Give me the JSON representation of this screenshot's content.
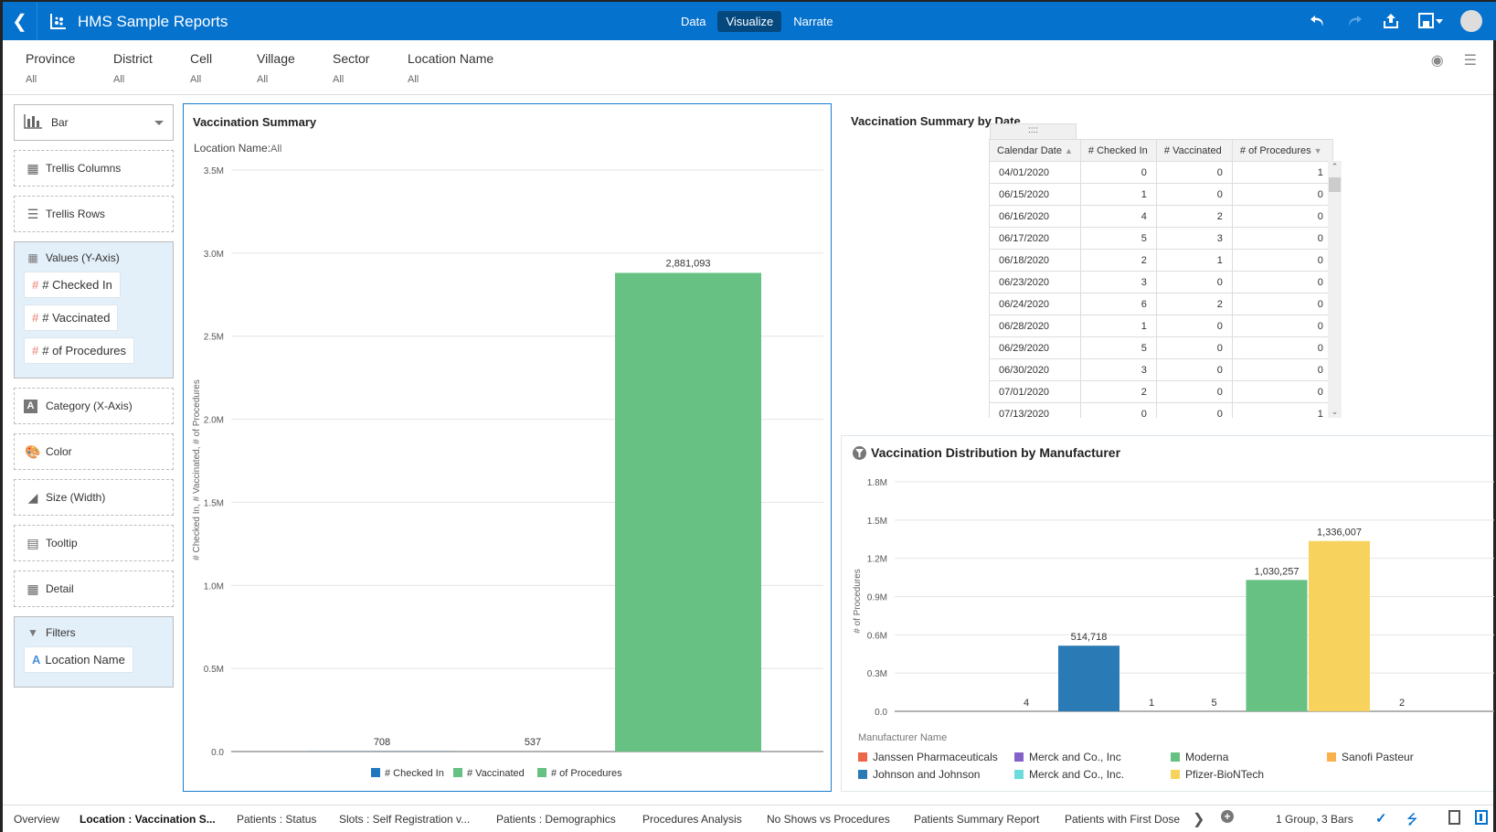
{
  "header": {
    "title": "HMS Sample Reports",
    "modes": [
      "Data",
      "Visualize",
      "Narrate"
    ],
    "active_mode": "Visualize",
    "icons": [
      "undo-icon",
      "redo-icon",
      "export-icon",
      "save-icon",
      "user-avatar"
    ]
  },
  "filters": [
    {
      "label": "Province",
      "value": "All"
    },
    {
      "label": "District",
      "value": "All"
    },
    {
      "label": "Cell",
      "value": "All"
    },
    {
      "label": "Village",
      "value": "All"
    },
    {
      "label": "Sector",
      "value": "All"
    },
    {
      "label": "Location Name",
      "value": "All"
    }
  ],
  "grammar": {
    "chart_type": "Bar",
    "trellis_columns": "Trellis Columns",
    "trellis_rows": "Trellis Rows",
    "values_label": "Values (Y-Axis)",
    "values": [
      "# Checked In",
      "# Vaccinated",
      "# of Procedures"
    ],
    "category": "Category (X-Axis)",
    "color": "Color",
    "size": "Size (Width)",
    "tooltip": "Tooltip",
    "detail": "Detail",
    "filters_label": "Filters",
    "filter_items": [
      "Location Name"
    ]
  },
  "summary": {
    "title": "Vaccination Summary",
    "subtitle_label": "Location Name:",
    "subtitle_value": "All"
  },
  "table": {
    "title": "Vaccination Summary by Date",
    "grip": "::::",
    "columns": [
      "Calendar Date",
      "# Checked In",
      "# Vaccinated",
      "# of Procedures"
    ],
    "rows": [
      [
        "04/01/2020",
        "0",
        "0",
        "1"
      ],
      [
        "06/15/2020",
        "1",
        "0",
        "0"
      ],
      [
        "06/16/2020",
        "4",
        "2",
        "0"
      ],
      [
        "06/17/2020",
        "5",
        "3",
        "0"
      ],
      [
        "06/18/2020",
        "2",
        "1",
        "0"
      ],
      [
        "06/23/2020",
        "3",
        "0",
        "0"
      ],
      [
        "06/24/2020",
        "6",
        "2",
        "0"
      ],
      [
        "06/28/2020",
        "1",
        "0",
        "0"
      ],
      [
        "06/29/2020",
        "5",
        "0",
        "0"
      ],
      [
        "06/30/2020",
        "3",
        "0",
        "0"
      ],
      [
        "07/01/2020",
        "2",
        "0",
        "0"
      ],
      [
        "07/13/2020",
        "0",
        "0",
        "1"
      ]
    ]
  },
  "distribution": {
    "title": "Vaccination Distribution by Manufacturer",
    "legend_title": "Manufacturer Name"
  },
  "chart_data": [
    {
      "type": "bar",
      "title": "Vaccination Summary",
      "ylabel": "# Checked In, # Vaccinated, # of Procedures",
      "xlabel": "",
      "ylim": [
        0,
        3500000
      ],
      "yticks": [
        0,
        500000,
        1000000,
        1500000,
        2000000,
        2500000,
        3000000,
        3500000
      ],
      "ytick_labels": [
        "0.0",
        "0.5M",
        "1.0M",
        "1.5M",
        "2.0M",
        "2.5M",
        "3.0M",
        "3.5M"
      ],
      "grid": true,
      "series": [
        {
          "name": "# Checked In",
          "value": 708,
          "label": "708",
          "color": "#1f77c0"
        },
        {
          "name": "# Vaccinated",
          "value": 537,
          "label": "537",
          "color": "#66c183"
        },
        {
          "name": "# of Procedures",
          "value": 2881093,
          "label": "2,881,093",
          "color": "#66c183"
        }
      ],
      "legend": "bottom"
    },
    {
      "type": "bar",
      "title": "Vaccination Distribution by Manufacturer",
      "ylabel": "# of Procedures",
      "xlabel": "",
      "ylim": [
        0,
        1800000
      ],
      "yticks": [
        0,
        300000,
        600000,
        900000,
        1200000,
        1500000,
        1800000
      ],
      "ytick_labels": [
        "0.0",
        "0.3M",
        "0.6M",
        "0.9M",
        "1.2M",
        "1.5M",
        "1.8M"
      ],
      "grid": true,
      "categories": [
        "Janssen Pharmaceuticals",
        "Johnson and Johnson",
        "Merck and Co., Inc",
        "Merck and Co., Inc.",
        "Moderna",
        "Pfizer-BioNTech",
        "Sanofi Pasteur"
      ],
      "values": [
        4,
        514718,
        1,
        5,
        1030257,
        1336007,
        2
      ],
      "labels": [
        "4",
        "514,718",
        "1",
        "5",
        "1,030,257",
        "1,336,007",
        "2"
      ],
      "colors": [
        "#ed6647",
        "#2a7ab5",
        "#8561c8",
        "#6ddbdb",
        "#66c183",
        "#f7d35e",
        "#fbb14b"
      ],
      "legend": "bottom"
    }
  ],
  "tabs": {
    "items": [
      "Overview",
      "Location : Vaccination S...",
      "Patients : Status",
      "Slots : Self Registration v...",
      "Patients : Demographics",
      "Procedures Analysis",
      "No Shows vs Procedures",
      "Patients Summary Report",
      "Patients with First Dose"
    ],
    "active": "Location : Vaccination S...",
    "status": "1 Group, 3 Bars"
  }
}
